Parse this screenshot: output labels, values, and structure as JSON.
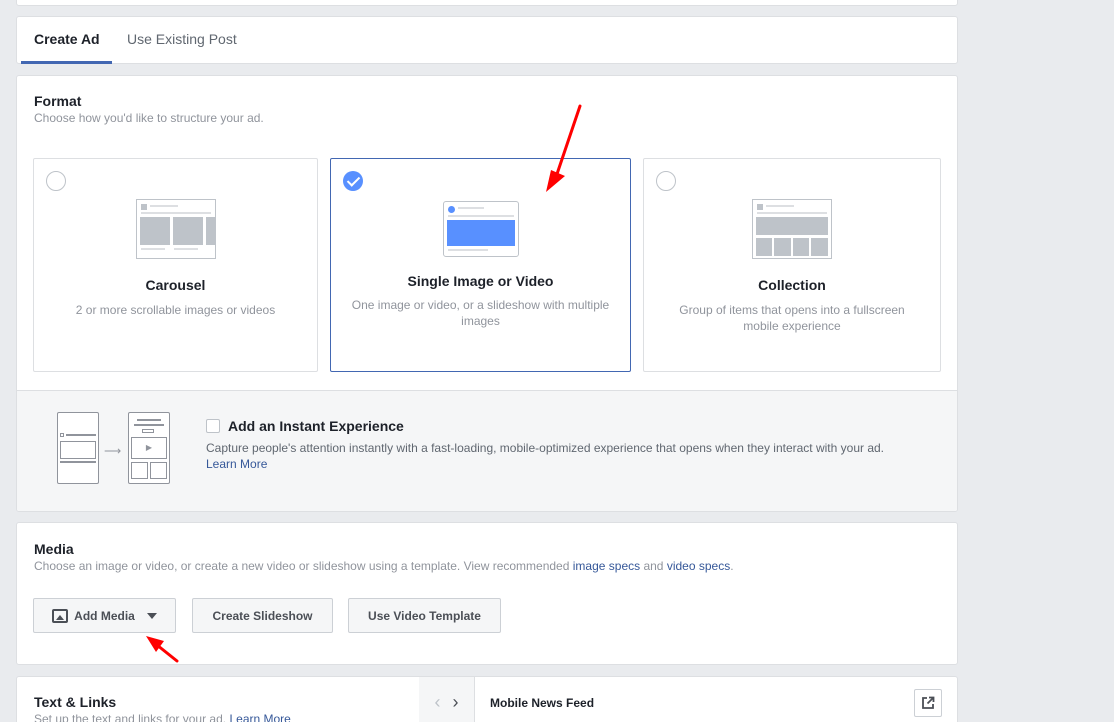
{
  "tabs": [
    {
      "label": "Create Ad",
      "active": true
    },
    {
      "label": "Use Existing Post",
      "active": false
    }
  ],
  "format": {
    "title": "Format",
    "subtitle": "Choose how you'd like to structure your ad.",
    "options": [
      {
        "title": "Carousel",
        "description": "2 or more scrollable images or videos",
        "selected": false
      },
      {
        "title": "Single Image or Video",
        "description": "One image or video, or a slideshow with multiple images",
        "selected": true
      },
      {
        "title": "Collection",
        "description": "Group of items that opens into a fullscreen mobile experience",
        "selected": false
      }
    ],
    "instant_experience": {
      "label": "Add an Instant Experience",
      "description": "Capture people's attention instantly with a fast-loading, mobile-optimized experience that opens when they interact with your ad.",
      "link": "Learn More",
      "checked": false
    }
  },
  "media": {
    "title": "Media",
    "subtitle_pre": "Choose an image or video, or create a new video or slideshow using a template. View recommended ",
    "link_image": "image specs",
    "subtitle_mid": " and ",
    "link_video": "video specs",
    "subtitle_post": ".",
    "buttons": {
      "add_media": "Add Media",
      "create_slideshow": "Create Slideshow",
      "use_video_template": "Use Video Template"
    }
  },
  "text_links": {
    "title": "Text & Links",
    "subtitle": "Set up the text and links for your ad.",
    "link": "Learn More",
    "placement": "Mobile News Feed"
  },
  "colors": {
    "accent": "#4267b2",
    "selected_check": "#5890ff",
    "link": "#365899",
    "annotation": "#ff0000"
  }
}
